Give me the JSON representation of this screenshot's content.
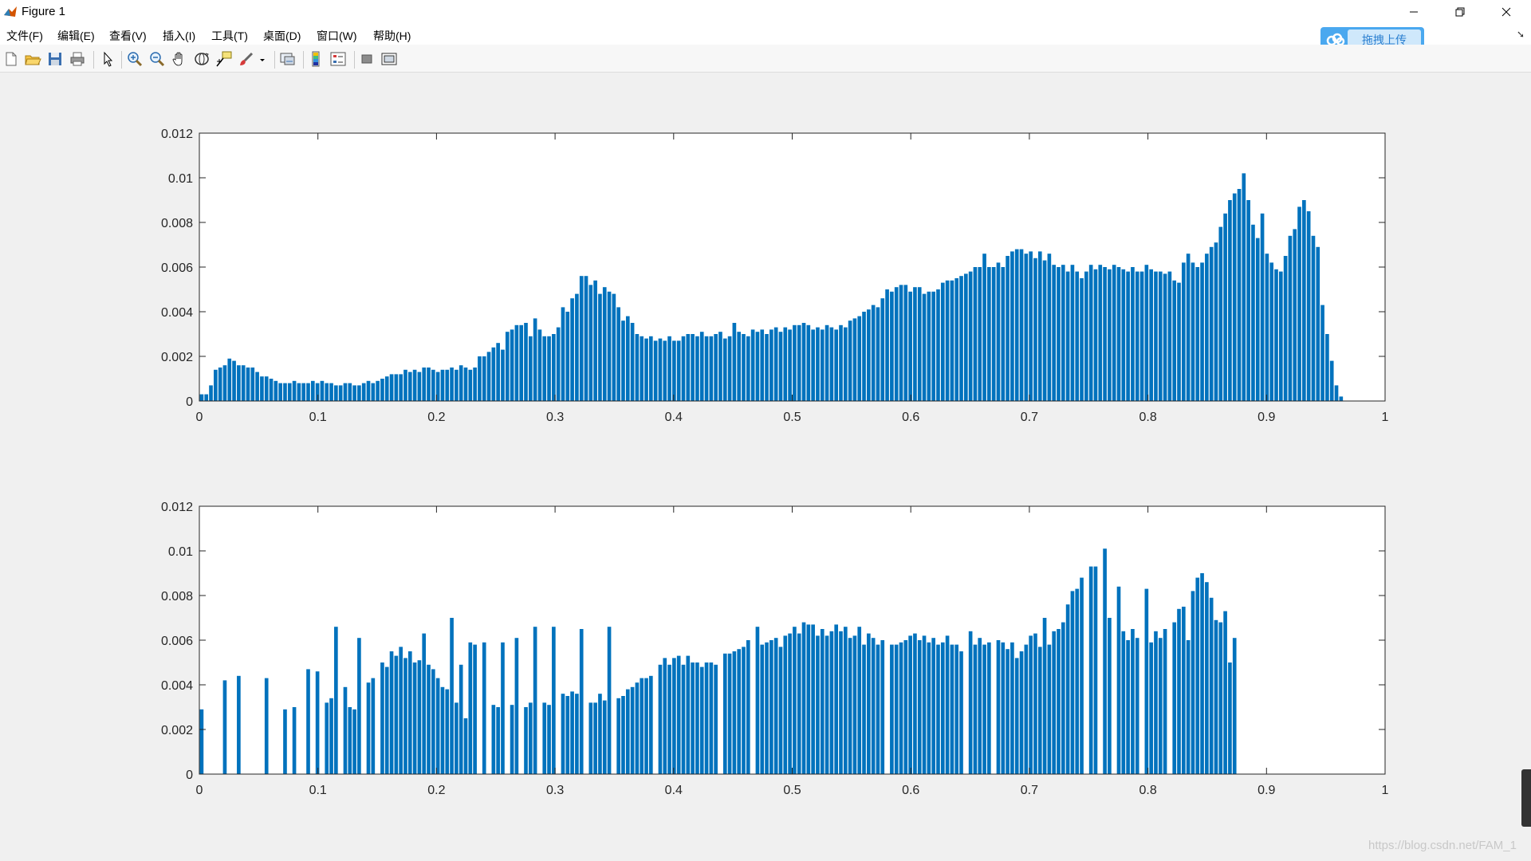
{
  "window": {
    "title": "Figure 1"
  },
  "menu": {
    "items": [
      "文件(F)",
      "编辑(E)",
      "查看(V)",
      "插入(I)",
      "工具(T)",
      "桌面(D)",
      "窗口(W)",
      "帮助(H)"
    ]
  },
  "toolbar": {
    "icons": [
      "new-figure-icon",
      "open-file-icon",
      "save-icon",
      "print-icon",
      "edit-plot-icon",
      "zoom-in-icon",
      "zoom-out-icon",
      "pan-icon",
      "rotate-3d-icon",
      "data-cursor-icon",
      "brush-icon",
      "link-plot-icon",
      "colorbar-icon",
      "legend-icon",
      "hide-plot-tools-icon",
      "show-plot-tools-icon"
    ]
  },
  "upload": {
    "label": "拖拽上传"
  },
  "watermark": "https://blog.csdn.net/FAM_1",
  "colors": {
    "bar": "#0072bd",
    "axes_bg": "#ffffff",
    "figure_bg": "#f0f0f0"
  },
  "chart_data": [
    {
      "type": "bar",
      "title": "",
      "xlabel": "",
      "ylabel": "",
      "xlim": [
        0,
        1
      ],
      "ylim": [
        0,
        0.012
      ],
      "xticks": [
        0,
        0.1,
        0.2,
        0.3,
        0.4,
        0.5,
        0.6,
        0.7,
        0.8,
        0.9,
        1
      ],
      "xtick_labels": [
        "0",
        "0.1",
        "0.2",
        "0.3",
        "0.4",
        "0.5",
        "0.6",
        "0.7",
        "0.8",
        "0.9",
        "1"
      ],
      "yticks": [
        0,
        0.002,
        0.004,
        0.006,
        0.008,
        0.01,
        0.012
      ],
      "ytick_labels": [
        "0",
        "0.002",
        "0.004",
        "0.006",
        "0.008",
        "0.01",
        "0.012"
      ],
      "grid": false,
      "bin_start": 0,
      "bin_width": 0.00390625,
      "values": [
        0.0003,
        0.0003,
        0.0007,
        0.0014,
        0.0015,
        0.0016,
        0.0019,
        0.0018,
        0.0016,
        0.0016,
        0.0015,
        0.0015,
        0.0013,
        0.0011,
        0.0011,
        0.001,
        0.0009,
        0.0008,
        0.0008,
        0.0008,
        0.0009,
        0.0008,
        0.0008,
        0.0008,
        0.0009,
        0.0008,
        0.0009,
        0.0008,
        0.0008,
        0.0007,
        0.0007,
        0.0008,
        0.0008,
        0.0007,
        0.0007,
        0.0008,
        0.0009,
        0.0008,
        0.0009,
        0.001,
        0.0011,
        0.0012,
        0.0012,
        0.0012,
        0.0014,
        0.0013,
        0.0014,
        0.0013,
        0.0015,
        0.0015,
        0.0014,
        0.0013,
        0.0014,
        0.0014,
        0.0015,
        0.0014,
        0.0016,
        0.0015,
        0.0014,
        0.0015,
        0.002,
        0.002,
        0.0022,
        0.0024,
        0.0026,
        0.0023,
        0.0031,
        0.0032,
        0.0034,
        0.0034,
        0.0035,
        0.0029,
        0.0037,
        0.0032,
        0.0029,
        0.0029,
        0.003,
        0.0033,
        0.0042,
        0.004,
        0.0046,
        0.0048,
        0.0056,
        0.0056,
        0.0052,
        0.0054,
        0.0048,
        0.0051,
        0.0049,
        0.0048,
        0.0042,
        0.0036,
        0.0038,
        0.0035,
        0.003,
        0.0029,
        0.0028,
        0.0029,
        0.0027,
        0.0028,
        0.0027,
        0.0029,
        0.0027,
        0.0027,
        0.0029,
        0.003,
        0.003,
        0.0029,
        0.0031,
        0.0029,
        0.0029,
        0.003,
        0.0031,
        0.0028,
        0.0029,
        0.0035,
        0.0031,
        0.003,
        0.0029,
        0.0032,
        0.0031,
        0.0032,
        0.003,
        0.0032,
        0.0033,
        0.0031,
        0.0033,
        0.0032,
        0.0034,
        0.0034,
        0.0035,
        0.0034,
        0.0032,
        0.0033,
        0.0032,
        0.0034,
        0.0033,
        0.0032,
        0.0034,
        0.0033,
        0.0036,
        0.0037,
        0.0038,
        0.004,
        0.0041,
        0.0043,
        0.0042,
        0.0046,
        0.005,
        0.0049,
        0.0051,
        0.0052,
        0.0052,
        0.0049,
        0.0051,
        0.0051,
        0.0048,
        0.0049,
        0.0049,
        0.005,
        0.0053,
        0.0054,
        0.0054,
        0.0055,
        0.0056,
        0.0057,
        0.0058,
        0.006,
        0.006,
        0.0066,
        0.006,
        0.006,
        0.0062,
        0.006,
        0.0065,
        0.0067,
        0.0068,
        0.0068,
        0.0066,
        0.0067,
        0.0064,
        0.0067,
        0.0063,
        0.0066,
        0.0061,
        0.006,
        0.0061,
        0.0058,
        0.0061,
        0.0058,
        0.0055,
        0.0058,
        0.0061,
        0.0059,
        0.0061,
        0.006,
        0.0059,
        0.0061,
        0.006,
        0.0059,
        0.0058,
        0.006,
        0.0058,
        0.0058,
        0.0061,
        0.0059,
        0.0058,
        0.0058,
        0.0057,
        0.0058,
        0.0054,
        0.0053,
        0.0062,
        0.0066,
        0.0062,
        0.006,
        0.0062,
        0.0066,
        0.0069,
        0.0071,
        0.0078,
        0.0084,
        0.009,
        0.0093,
        0.0095,
        0.0102,
        0.009,
        0.0079,
        0.0073,
        0.0084,
        0.0066,
        0.0062,
        0.0059,
        0.0058,
        0.0065,
        0.0074,
        0.0077,
        0.0087,
        0.009,
        0.0085,
        0.0074,
        0.0069,
        0.0043,
        0.003,
        0.0018,
        0.0007,
        0.0002
      ]
    },
    {
      "type": "bar",
      "title": "",
      "xlabel": "",
      "ylabel": "",
      "xlim": [
        0,
        1
      ],
      "ylim": [
        0,
        0.012
      ],
      "xticks": [
        0,
        0.1,
        0.2,
        0.3,
        0.4,
        0.5,
        0.6,
        0.7,
        0.8,
        0.9,
        1
      ],
      "xtick_labels": [
        "0",
        "0.1",
        "0.2",
        "0.3",
        "0.4",
        "0.5",
        "0.6",
        "0.7",
        "0.8",
        "0.9",
        "1"
      ],
      "yticks": [
        0,
        0.002,
        0.004,
        0.006,
        0.008,
        0.01,
        0.012
      ],
      "ytick_labels": [
        "0",
        "0.002",
        "0.004",
        "0.006",
        "0.008",
        "0.01",
        "0.012"
      ],
      "grid": false,
      "bin_start": 0,
      "bin_width": 0.00390625,
      "values": [
        0.0029,
        0,
        0,
        0,
        0,
        0.0042,
        0,
        0,
        0.0044,
        0,
        0,
        0,
        0,
        0,
        0.0043,
        0,
        0,
        0,
        0.0029,
        0,
        0.003,
        0,
        0,
        0.0047,
        0,
        0.0046,
        0,
        0.0032,
        0.0034,
        0.0066,
        0,
        0.0039,
        0.003,
        0.0029,
        0.0061,
        0,
        0.0041,
        0.0043,
        0,
        0.005,
        0.0048,
        0.0055,
        0.0053,
        0.0057,
        0.0052,
        0.0055,
        0.005,
        0.0051,
        0.0063,
        0.0049,
        0.0047,
        0.0043,
        0.0039,
        0.0038,
        0.007,
        0.0032,
        0.0049,
        0.0025,
        0.0059,
        0.0058,
        0,
        0.0059,
        0,
        0.0031,
        0.003,
        0.0059,
        0,
        0.0031,
        0.0061,
        0,
        0.003,
        0.0032,
        0.0066,
        0,
        0.0032,
        0.0031,
        0.0066,
        0,
        0.0036,
        0.0035,
        0.0037,
        0.0036,
        0.0065,
        0,
        0.0032,
        0.0032,
        0.0036,
        0.0033,
        0.0066,
        0,
        0.0034,
        0.0035,
        0.0038,
        0.0039,
        0.0041,
        0.0043,
        0.0043,
        0.0044,
        0,
        0.0049,
        0.0052,
        0.0049,
        0.0052,
        0.0053,
        0.0049,
        0.0053,
        0.005,
        0.005,
        0.0048,
        0.005,
        0.005,
        0.0049,
        0,
        0.0054,
        0.0054,
        0.0055,
        0.0056,
        0.0057,
        0.006,
        0,
        0.0066,
        0.0058,
        0.0059,
        0.006,
        0.0061,
        0.0057,
        0.0062,
        0.0063,
        0.0066,
        0.0063,
        0.0068,
        0.0067,
        0.0067,
        0.0062,
        0.0065,
        0.0062,
        0.0064,
        0.0067,
        0.0064,
        0.0066,
        0.0061,
        0.0062,
        0.0066,
        0.0058,
        0.0063,
        0.0061,
        0.0058,
        0.006,
        0,
        0.0058,
        0.0058,
        0.0059,
        0.006,
        0.0062,
        0.0063,
        0.006,
        0.0062,
        0.0059,
        0.0061,
        0.0058,
        0.0059,
        0.0062,
        0.0058,
        0.0058,
        0.0055,
        0,
        0.0064,
        0.0058,
        0.0061,
        0.0058,
        0.0059,
        0,
        0.006,
        0.0059,
        0.0056,
        0.0059,
        0.0052,
        0.0055,
        0.0058,
        0.0062,
        0.0063,
        0.0057,
        0.007,
        0.0058,
        0.0064,
        0.0065,
        0.0068,
        0.0076,
        0.0082,
        0.0083,
        0.0088,
        0,
        0.0093,
        0.0093,
        0,
        0.0101,
        0.007,
        0,
        0.0084,
        0.0064,
        0.006,
        0.0065,
        0.0061,
        0,
        0.0083,
        0.0059,
        0.0064,
        0.0061,
        0.0065,
        0,
        0.0068,
        0.0074,
        0.0075,
        0.006,
        0.0082,
        0.0088,
        0.009,
        0.0086,
        0.0079,
        0.0069,
        0.0068,
        0.0073,
        0.005,
        0.0061
      ]
    }
  ]
}
